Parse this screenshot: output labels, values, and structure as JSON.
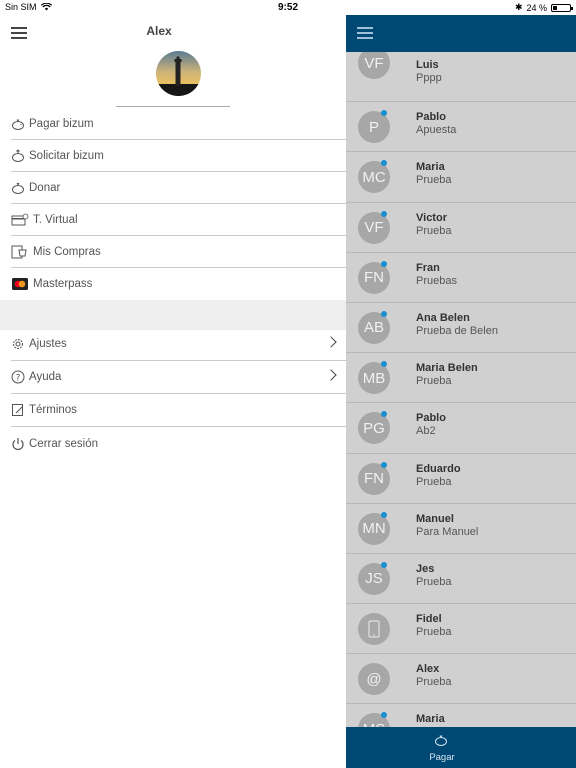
{
  "status_bar": {
    "carrier": "Sin SIM",
    "time": "9:52",
    "battery": "24 %",
    "battery_level": 0.24
  },
  "left_menu": {
    "user_name": "Alex",
    "items": [
      {
        "label": "Pagar bizum",
        "icon": "piggy-bank-icon"
      },
      {
        "label": "Solicitar bizum",
        "icon": "request-money-icon"
      },
      {
        "label": "Donar",
        "icon": "donate-icon"
      },
      {
        "label": "T. Virtual",
        "icon": "virtual-card-icon"
      },
      {
        "label": "Mis Compras",
        "icon": "purchases-icon"
      },
      {
        "label": "Masterpass",
        "icon": "masterpass-icon"
      }
    ],
    "settings_items": [
      {
        "label": "Ajustes",
        "icon": "gear-icon"
      },
      {
        "label": "Ayuda",
        "icon": "help-icon"
      },
      {
        "label": "Términos",
        "icon": "terms-icon"
      },
      {
        "label": "Cerrar sesión",
        "icon": "power-icon"
      }
    ]
  },
  "contacts": [
    {
      "initials": "VF",
      "name": "Luis",
      "subtitle": "Pppp",
      "dot": true
    },
    {
      "initials": "P",
      "name": "Pablo",
      "subtitle": "Apuesta",
      "dot": true
    },
    {
      "initials": "MC",
      "name": "Maria",
      "subtitle": "Prueba",
      "dot": true
    },
    {
      "initials": "VF",
      "name": "Victor",
      "subtitle": "Prueba",
      "dot": true
    },
    {
      "initials": "FN",
      "name": "Fran",
      "subtitle": "Pruebas",
      "dot": true
    },
    {
      "initials": "AB",
      "name": "Ana Belen",
      "subtitle": "Prueba de Belen",
      "dot": true
    },
    {
      "initials": "MB",
      "name": "Maria Belen",
      "subtitle": "Prueba",
      "dot": true
    },
    {
      "initials": "PG",
      "name": "Pablo",
      "subtitle": "Ab2",
      "dot": true
    },
    {
      "initials": "FN",
      "name": "Eduardo",
      "subtitle": "Prueba",
      "dot": true
    },
    {
      "initials": "MN",
      "name": "Manuel",
      "subtitle": "Para Manuel",
      "dot": true
    },
    {
      "initials": "JS",
      "name": "Jes",
      "subtitle": "Prueba",
      "dot": true
    },
    {
      "initials": "",
      "name": "Fidel",
      "subtitle": "Prueba",
      "dot": false,
      "icon": "phone-icon"
    },
    {
      "initials": "@",
      "name": "Alex",
      "subtitle": "Prueba",
      "dot": false
    },
    {
      "initials": "MS",
      "name": "Maria",
      "subtitle": "",
      "dot": true
    }
  ],
  "bottom_bar": {
    "pay_label": "Pagar"
  },
  "colors": {
    "header": "#004974",
    "contact_bg": "#d0d0d0",
    "avatar": "#a7a7a7",
    "dot": "#1a8fd0"
  }
}
